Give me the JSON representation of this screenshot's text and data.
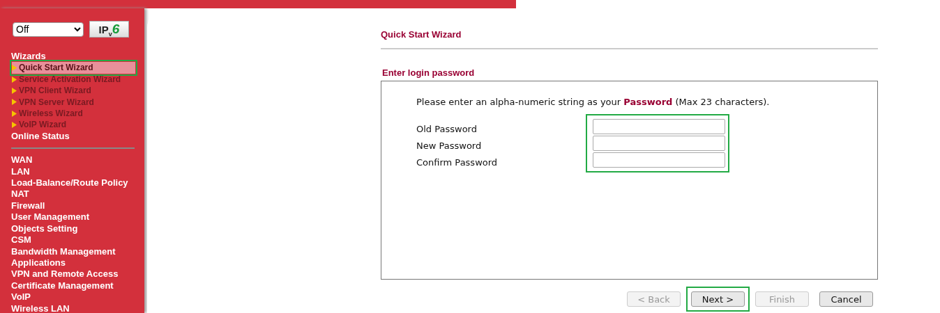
{
  "sidebar": {
    "mode_select": {
      "value": "Off"
    },
    "ipv6_button": {
      "label": "IP",
      "sub": "v",
      "suffix": "6"
    },
    "items": [
      {
        "label": "Wizards",
        "kind": "header",
        "selected": false,
        "highlight": false
      },
      {
        "label": "Quick Start Wizard",
        "kind": "wizard",
        "selected": true,
        "highlight": true
      },
      {
        "label": "Service Activation Wizard",
        "kind": "wizard",
        "selected": false,
        "highlight": false
      },
      {
        "label": "VPN Client Wizard",
        "kind": "wizard",
        "selected": false,
        "highlight": false
      },
      {
        "label": "VPN Server Wizard",
        "kind": "wizard",
        "selected": false,
        "highlight": false
      },
      {
        "label": "Wireless Wizard",
        "kind": "wizard",
        "selected": false,
        "highlight": false
      },
      {
        "label": "VoIP Wizard",
        "kind": "wizard",
        "selected": false,
        "highlight": false
      },
      {
        "label": "Online Status",
        "kind": "header",
        "selected": false,
        "highlight": false
      },
      {
        "kind": "divider"
      },
      {
        "label": "WAN",
        "kind": "header",
        "selected": false,
        "highlight": false
      },
      {
        "label": "LAN",
        "kind": "header",
        "selected": false,
        "highlight": false
      },
      {
        "label": "Load-Balance/Route Policy",
        "kind": "header",
        "selected": false,
        "highlight": false
      },
      {
        "label": "NAT",
        "kind": "header",
        "selected": false,
        "highlight": false
      },
      {
        "label": "Firewall",
        "kind": "header",
        "selected": false,
        "highlight": false
      },
      {
        "label": "User Management",
        "kind": "header",
        "selected": false,
        "highlight": false
      },
      {
        "label": "Objects Setting",
        "kind": "header",
        "selected": false,
        "highlight": false
      },
      {
        "label": "CSM",
        "kind": "header",
        "selected": false,
        "highlight": false
      },
      {
        "label": "Bandwidth Management",
        "kind": "header",
        "selected": false,
        "highlight": false
      },
      {
        "label": "Applications",
        "kind": "header",
        "selected": false,
        "highlight": false
      },
      {
        "label": "VPN and Remote Access",
        "kind": "header",
        "selected": false,
        "highlight": false
      },
      {
        "label": "Certificate Management",
        "kind": "header",
        "selected": false,
        "highlight": false
      },
      {
        "label": "VoIP",
        "kind": "header",
        "selected": false,
        "highlight": false
      },
      {
        "label": "Wireless LAN",
        "kind": "header",
        "selected": false,
        "highlight": false
      }
    ]
  },
  "page_title": "Quick Start Wizard",
  "section_title": "Enter login password",
  "instruction": "Please enter an alpha-numeric string as your  **Password** (Max 23 characters).",
  "fields_highlight": true,
  "fields": [
    {
      "label": "Old Password"
    },
    {
      "label": "New Password"
    },
    {
      "label": "Confirm Password"
    }
  ],
  "buttons": [
    {
      "label": "< Back",
      "disabled": true,
      "highlight": false
    },
    {
      "label": "Next >",
      "disabled": false,
      "highlight": true
    },
    {
      "label": "Finish",
      "disabled": true,
      "highlight": false
    },
    {
      "label": "Cancel",
      "disabled": false,
      "highlight": false
    }
  ]
}
